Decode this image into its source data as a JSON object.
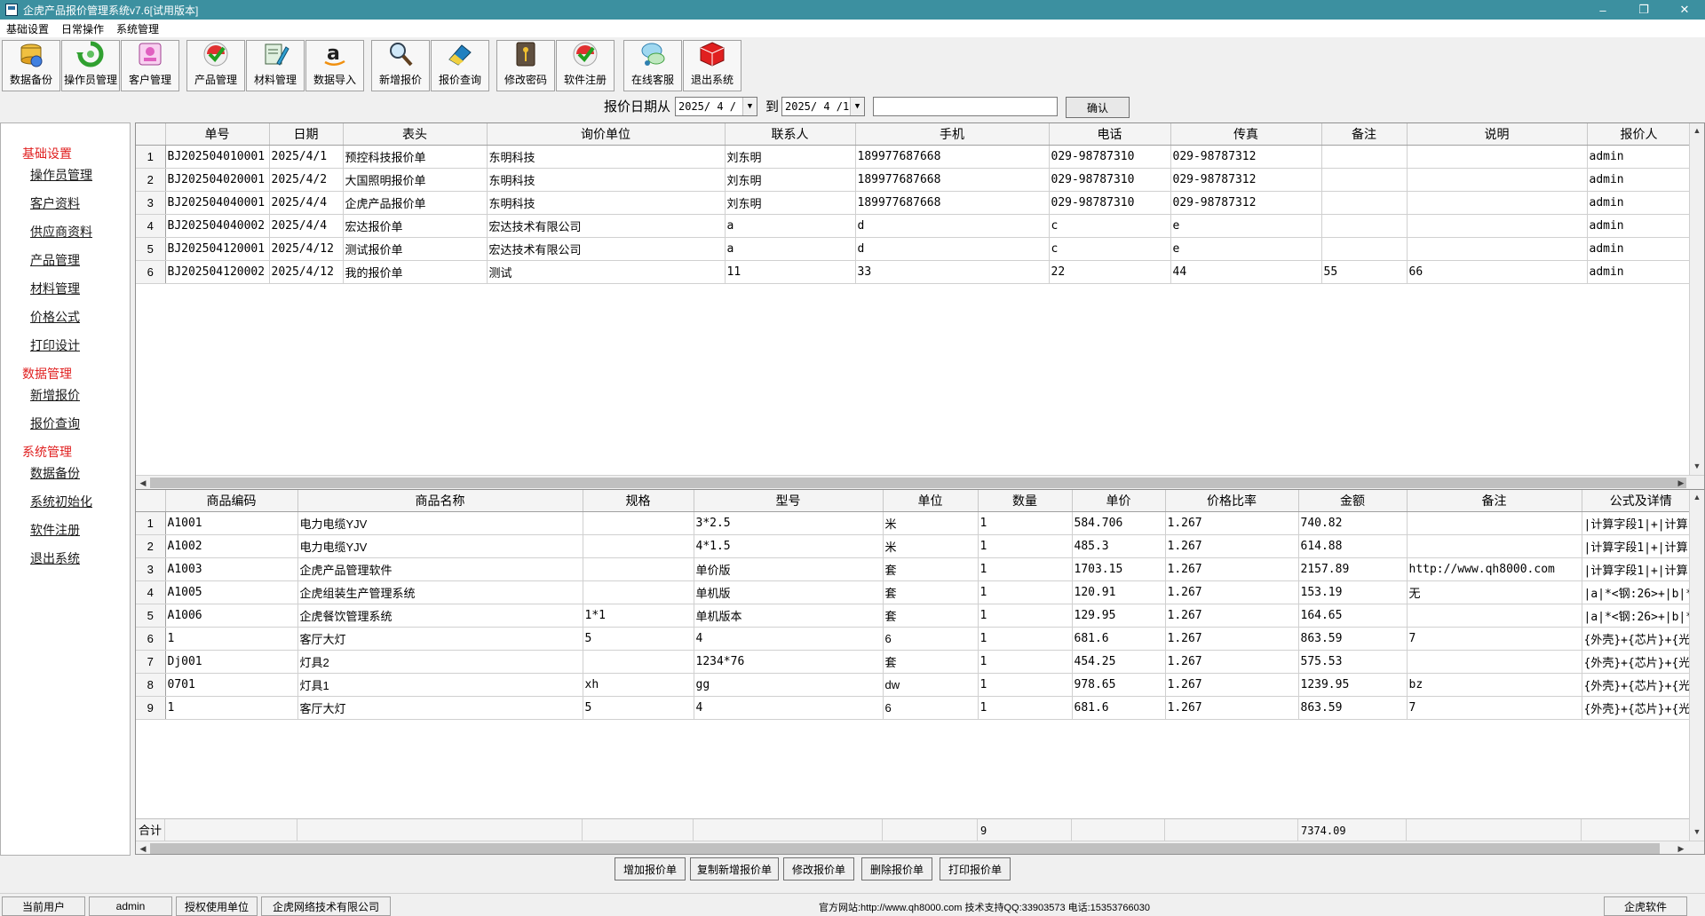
{
  "window": {
    "title": "企虎产品报价管理系统v7.6[试用版本]",
    "minimize": "–",
    "maximize": "❐",
    "close": "✕"
  },
  "menu": [
    "基础设置",
    "日常操作",
    "系统管理"
  ],
  "toolbar": [
    {
      "label": "数据备份",
      "icon": "database-backup-icon"
    },
    {
      "label": "操作员管理",
      "icon": "refresh-users-icon"
    },
    {
      "label": "客户管理",
      "icon": "customer-card-icon"
    },
    {
      "label": "产品管理",
      "icon": "checkmark-badge-icon"
    },
    {
      "label": "材料管理",
      "icon": "pencil-document-icon"
    },
    {
      "label": "数据导入",
      "icon": "amazon-a-icon"
    },
    {
      "label": "新增报价",
      "icon": "magnifier-icon"
    },
    {
      "label": "报价查询",
      "icon": "eraser-icon"
    },
    {
      "label": "修改密码",
      "icon": "key-icon"
    },
    {
      "label": "软件注册",
      "icon": "register-badge-icon"
    },
    {
      "label": "在线客服",
      "icon": "chat-bubbles-icon"
    },
    {
      "label": "退出系统",
      "icon": "red-cube-icon"
    }
  ],
  "filter": {
    "label_from": "报价日期从",
    "date_from": "2025/ 4 / 1",
    "label_to": "到",
    "date_to": "2025/ 4 /16",
    "search_value": "",
    "confirm": "确认"
  },
  "sidebar": [
    {
      "type": "group",
      "label": "基础设置"
    },
    {
      "type": "item",
      "label": "操作员管理"
    },
    {
      "type": "item",
      "label": "客户资料"
    },
    {
      "type": "item",
      "label": "供应商资料"
    },
    {
      "type": "item",
      "label": "产品管理"
    },
    {
      "type": "item",
      "label": "材料管理"
    },
    {
      "type": "item",
      "label": "价格公式"
    },
    {
      "type": "item",
      "label": "打印设计"
    },
    {
      "type": "group",
      "label": "数据管理"
    },
    {
      "type": "item",
      "label": "新增报价"
    },
    {
      "type": "item",
      "label": "报价查询"
    },
    {
      "type": "group",
      "label": "系统管理"
    },
    {
      "type": "item",
      "label": "数据备份"
    },
    {
      "type": "item",
      "label": "系统初始化"
    },
    {
      "type": "item",
      "label": "软件注册"
    },
    {
      "type": "item",
      "label": "退出系统"
    }
  ],
  "quotes": {
    "columns": [
      "单号",
      "日期",
      "表头",
      "询价单位",
      "联系人",
      "手机",
      "电话",
      "传真",
      "备注",
      "说明",
      "报价人"
    ],
    "rows": [
      [
        "1",
        "BJ202504010001",
        "2025/4/1",
        "预控科技报价单",
        "东明科技",
        "刘东明",
        "189977687668",
        "029-98787310",
        "029-98787312",
        "",
        "",
        "admin"
      ],
      [
        "2",
        "BJ202504020001",
        "2025/4/2",
        "大国照明报价单",
        "东明科技",
        "刘东明",
        "189977687668",
        "029-98787310",
        "029-98787312",
        "",
        "",
        "admin"
      ],
      [
        "3",
        "BJ202504040001",
        "2025/4/4",
        "企虎产品报价单",
        "东明科技",
        "刘东明",
        "189977687668",
        "029-98787310",
        "029-98787312",
        "",
        "",
        "admin"
      ],
      [
        "4",
        "BJ202504040002",
        "2025/4/4",
        "宏达报价单",
        "宏达技术有限公司",
        "a",
        "d",
        "c",
        "e",
        "",
        "",
        "admin"
      ],
      [
        "5",
        "BJ202504120001",
        "2025/4/12",
        "测试报价单",
        "宏达技术有限公司",
        "a",
        "d",
        "c",
        "e",
        "",
        "",
        "admin"
      ],
      [
        "6",
        "BJ202504120002",
        "2025/4/12",
        "我的报价单",
        "测试",
        "11",
        "33",
        "22",
        "44",
        "55",
        "66",
        "admin"
      ]
    ]
  },
  "items": {
    "columns": [
      "商品编码",
      "商品名称",
      "规格",
      "型号",
      "单位",
      "数量",
      "单价",
      "价格比率",
      "金额",
      "备注",
      "公式及详情"
    ],
    "rows": [
      [
        "1",
        "A1001",
        "电力电缆YJV",
        "",
        "3*2.5",
        "米",
        "1",
        "584.706",
        "1.267",
        "740.82",
        "",
        "|计算字段1|+|计算"
      ],
      [
        "2",
        "A1002",
        "电力电缆YJV",
        "",
        "4*1.5",
        "米",
        "1",
        "485.3",
        "1.267",
        "614.88",
        "",
        "|计算字段1|+|计算"
      ],
      [
        "3",
        "A1003",
        "企虎产品管理软件",
        "",
        "单价版",
        "套",
        "1",
        "1703.15",
        "1.267",
        "2157.89",
        "http://www.qh8000.com",
        "|计算字段1|+|计算"
      ],
      [
        "4",
        "A1005",
        "企虎组装生产管理系统",
        "",
        "单机版",
        "套",
        "1",
        "120.91",
        "1.267",
        "153.19",
        "无",
        "|a|*<钢:26>+|b|*<"
      ],
      [
        "5",
        "A1006",
        "企虎餐饮管理系统",
        "1*1",
        "单机版本",
        "套",
        "1",
        "129.95",
        "1.267",
        "164.65",
        "",
        "|a|*<钢:26>+|b|*<"
      ],
      [
        "6",
        "1",
        "客厅大灯",
        "5",
        "4",
        "6",
        "1",
        "681.6",
        "1.267",
        "863.59",
        "7",
        "{外壳}+{芯片}+{光"
      ],
      [
        "7",
        "Dj001",
        "灯具2",
        "",
        "1234*76",
        "套",
        "1",
        "454.25",
        "1.267",
        "575.53",
        "",
        "{外壳}+{芯片}+{光"
      ],
      [
        "8",
        "0701",
        "灯具1",
        "xh",
        "gg",
        "dw",
        "1",
        "978.65",
        "1.267",
        "1239.95",
        "bz",
        "{外壳}+{芯片}+{光"
      ],
      [
        "9",
        "1",
        "客厅大灯",
        "5",
        "4",
        "6",
        "1",
        "681.6",
        "1.267",
        "863.59",
        "7",
        "{外壳}+{芯片}+{光"
      ]
    ],
    "total_label": "合计",
    "total_qty": "9",
    "total_amount": "7374.09"
  },
  "actions": [
    "增加报价单",
    "复制新增报价单",
    "修改报价单",
    "删除报价单",
    "打印报价单"
  ],
  "status": {
    "user_label": "当前用户",
    "user_value": "admin",
    "license_label": "授权使用单位",
    "license_value": "企虎网络技术有限公司",
    "center_text": "官方网站:http://www.qh8000.com 技术支持QQ:33903573 电话:15353766030",
    "brand": "企虎软件"
  }
}
